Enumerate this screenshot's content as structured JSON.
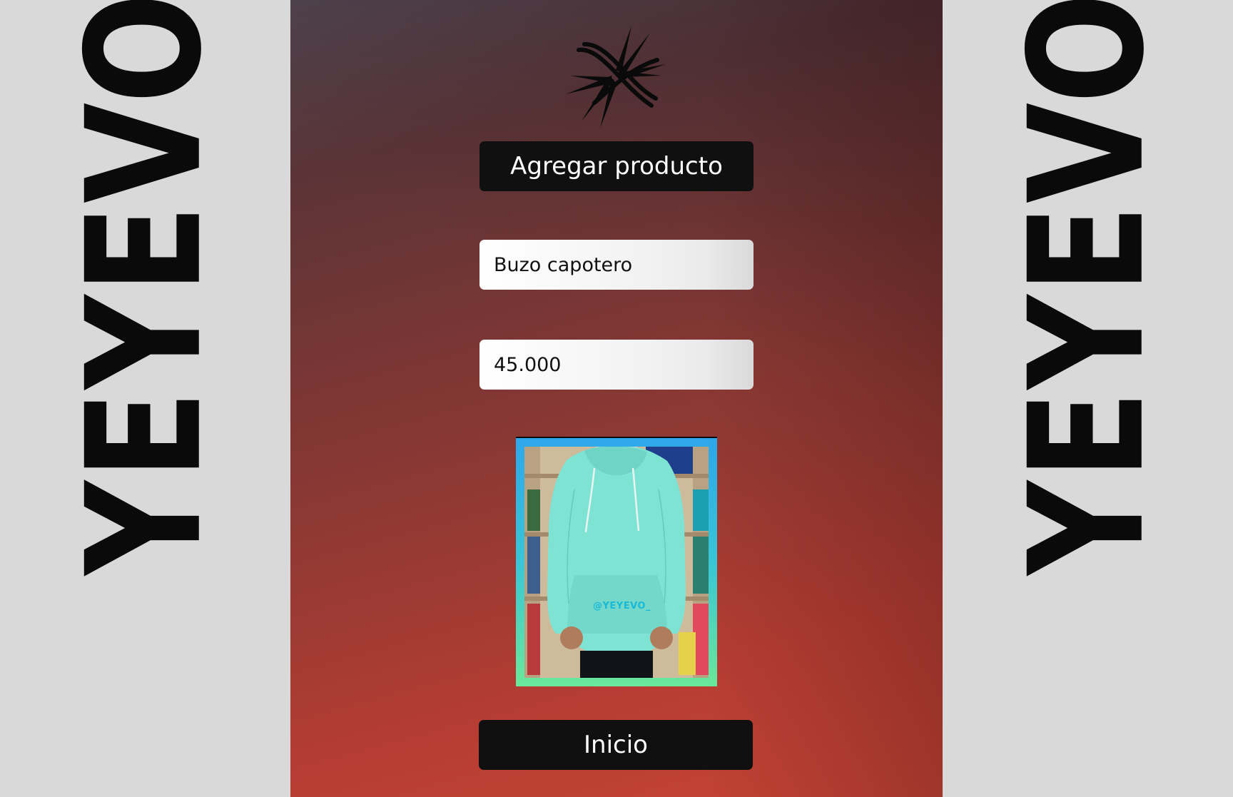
{
  "brand": {
    "left_wordmark": "YEYEVO",
    "right_wordmark": "YEYEVO",
    "logo_icon": "starburst-x-logo"
  },
  "actions": {
    "add_product_label": "Agregar producto",
    "home_label": "Inicio"
  },
  "form": {
    "product_name_value": "Buzo capotero",
    "product_price_value": "45.000"
  },
  "product_image": {
    "watermark": "@YEYEVO_"
  },
  "colors": {
    "side_background": "#d9d9d9",
    "panel_gradient_top": "#534650",
    "panel_gradient_bottom": "#c84436",
    "button_background": "#101010",
    "frame_top": "#2fa7ea",
    "frame_bottom": "#6be89a",
    "hoodie": "#7fe3d4"
  }
}
